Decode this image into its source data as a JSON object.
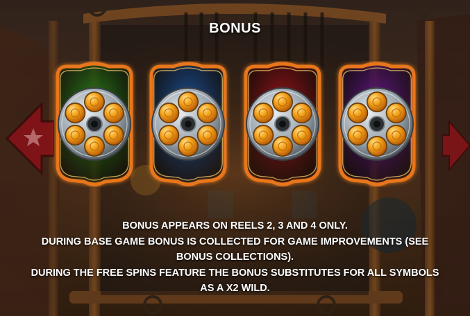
{
  "screen": {
    "title": "BONUS",
    "description_lines": [
      "BONUS APPEARS ON REELS 2, 3 AND 4 ONLY.",
      "DURING BASE GAME BONUS IS COLLECTED FOR GAME IMPROVEMENTS (SEE",
      "BONUS COLLECTIONS).",
      "DURING THE FREE SPINS FEATURE THE BONUS SUBSTITUTES FOR ALL SYMBOLS",
      "AS A X2 WILD."
    ]
  },
  "bonus_symbols": [
    {
      "name": "green-revolver-cylinder",
      "color": "#2f8a1e"
    },
    {
      "name": "blue-revolver-cylinder",
      "color": "#1f5aa8"
    },
    {
      "name": "red-revolver-cylinder",
      "color": "#a8161c"
    },
    {
      "name": "purple-revolver-cylinder",
      "color": "#6c1a96"
    }
  ],
  "colors": {
    "frame_orange": "#e8761c",
    "bullet_gold": "#f2a21a",
    "cylinder_steel": "#9aa4ad"
  }
}
